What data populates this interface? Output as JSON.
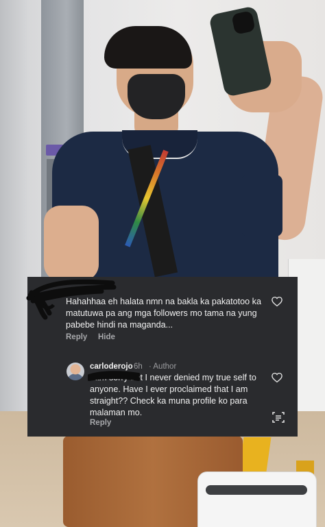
{
  "comment": {
    "text": "Hahahhaa eh halata nmn na bakla ka pakatotoo ka matutuwa pa ang mga followers mo tama na yung pabebe hindi na maganda...",
    "reply_label": "Reply",
    "hide_label": "Hide",
    "like_icon": "heart-outline-icon"
  },
  "reply": {
    "username": "carloderojo",
    "timestamp": "6h",
    "author_label": "· Author",
    "text": "I am sorry but I never denied my true self to anyone. Have I ever proclaimed that I am straight?? Check ka muna profile ko para malaman mo.",
    "reply_label": "Reply",
    "like_icon": "heart-outline-icon",
    "translate_icon": "translate-icon"
  },
  "colors": {
    "card_bg": "#2a2b2e",
    "text": "#f1f1f1",
    "muted": "#a7a8ab"
  }
}
